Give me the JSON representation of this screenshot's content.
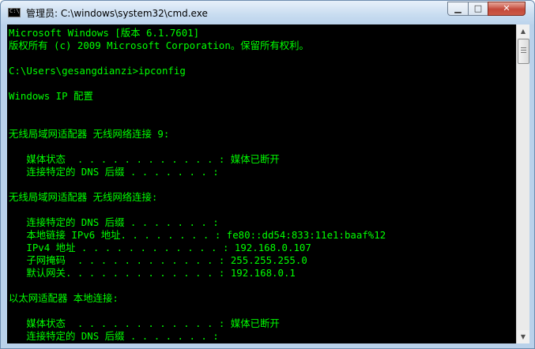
{
  "window": {
    "title": "管理员: C:\\windows\\system32\\cmd.exe",
    "icon": "cmd-icon",
    "controls": {
      "minimize": "▁",
      "maximize": "□",
      "close": "✕"
    }
  },
  "console": {
    "text_color": "#00ff00",
    "background": "#000000",
    "lines": [
      "Microsoft Windows [版本 6.1.7601]",
      "版权所有 (c) 2009 Microsoft Corporation。保留所有权利。",
      "",
      "C:\\Users\\gesangdianzi>ipconfig",
      "",
      "Windows IP 配置",
      "",
      "",
      "无线局域网适配器 无线网络连接 9:",
      "",
      "   媒体状态  . . . . . . . . . . . . : 媒体已断开",
      "   连接特定的 DNS 后缀 . . . . . . . :",
      "",
      "无线局域网适配器 无线网络连接:",
      "",
      "   连接特定的 DNS 后缀 . . . . . . . :",
      "   本地链接 IPv6 地址. . . . . . . . : fe80::dd54:833:11e1:baaf%12",
      "   IPv4 地址 . . . . . . . . . . . . : 192.168.0.107",
      "   子网掩码  . . . . . . . . . . . . : 255.255.255.0",
      "   默认网关. . . . . . . . . . . . . : 192.168.0.1",
      "",
      "以太网适配器 本地连接:",
      "",
      "   媒体状态  . . . . . . . . . . . . : 媒体已断开",
      "   连接特定的 DNS 后缀 . . . . . . . :"
    ]
  },
  "scrollbar": {
    "up_arrow": "▲",
    "down_arrow": "▼"
  }
}
